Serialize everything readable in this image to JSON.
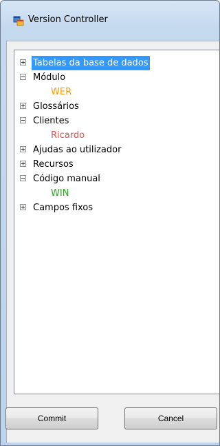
{
  "window": {
    "title": "Version Controller",
    "icon": "app-window-icon"
  },
  "tree": {
    "nodes": [
      {
        "label": "Tabelas da base de dados",
        "expanded": false,
        "selected": true,
        "children": []
      },
      {
        "label": "Módulo",
        "expanded": true,
        "selected": false,
        "children": [
          {
            "label": "WER",
            "color": "#ff9900"
          }
        ]
      },
      {
        "label": "Glossários",
        "expanded": false,
        "selected": false,
        "children": []
      },
      {
        "label": "Clientes",
        "expanded": true,
        "selected": false,
        "children": [
          {
            "label": "Ricardo",
            "color": "#e05050"
          }
        ]
      },
      {
        "label": "Ajudas ao utilizador",
        "expanded": false,
        "selected": false,
        "children": []
      },
      {
        "label": "Recursos",
        "expanded": false,
        "selected": false,
        "children": []
      },
      {
        "label": "Código manual",
        "expanded": true,
        "selected": false,
        "children": [
          {
            "label": "WIN",
            "color": "#33a02c"
          }
        ]
      },
      {
        "label": "Campos fixos",
        "expanded": false,
        "selected": false,
        "children": []
      }
    ]
  },
  "buttons": {
    "commit_label": "Commit",
    "cancel_label": "Cancel"
  }
}
